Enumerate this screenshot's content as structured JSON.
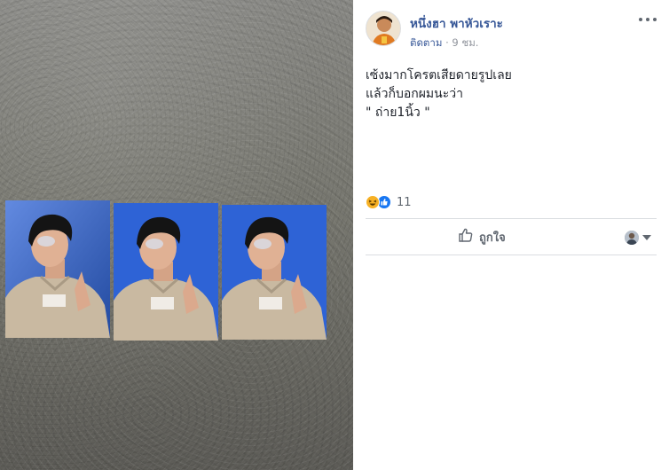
{
  "post": {
    "author": "หนึ่งฮา พาหัวเราะ",
    "follow_label": "ติดตาม",
    "separator": " · ",
    "time": "9 ชม.",
    "caption_lines": [
      "เซ้งมากโครตเสียดายรูปเลย",
      "แล้วก็บอกผมนะว่า",
      "\" ถ่าย1นิ้ว \""
    ],
    "reaction_count": "11",
    "like_label": "ถูกใจ"
  },
  "icons": {
    "more": "more-options-icon",
    "haha": "haha-reaction-icon",
    "like_reaction": "like-reaction-icon",
    "like": "thumbs-up-icon",
    "chevron": "chevron-down-icon"
  },
  "colors": {
    "author_link": "#385898",
    "meta_gray": "#90949c",
    "text": "#1d2129",
    "divider": "#dadde1",
    "like_blue": "#1877f2",
    "haha_yellow": "#f7b125",
    "photo_backdrop_blue": "#2e63d6"
  }
}
